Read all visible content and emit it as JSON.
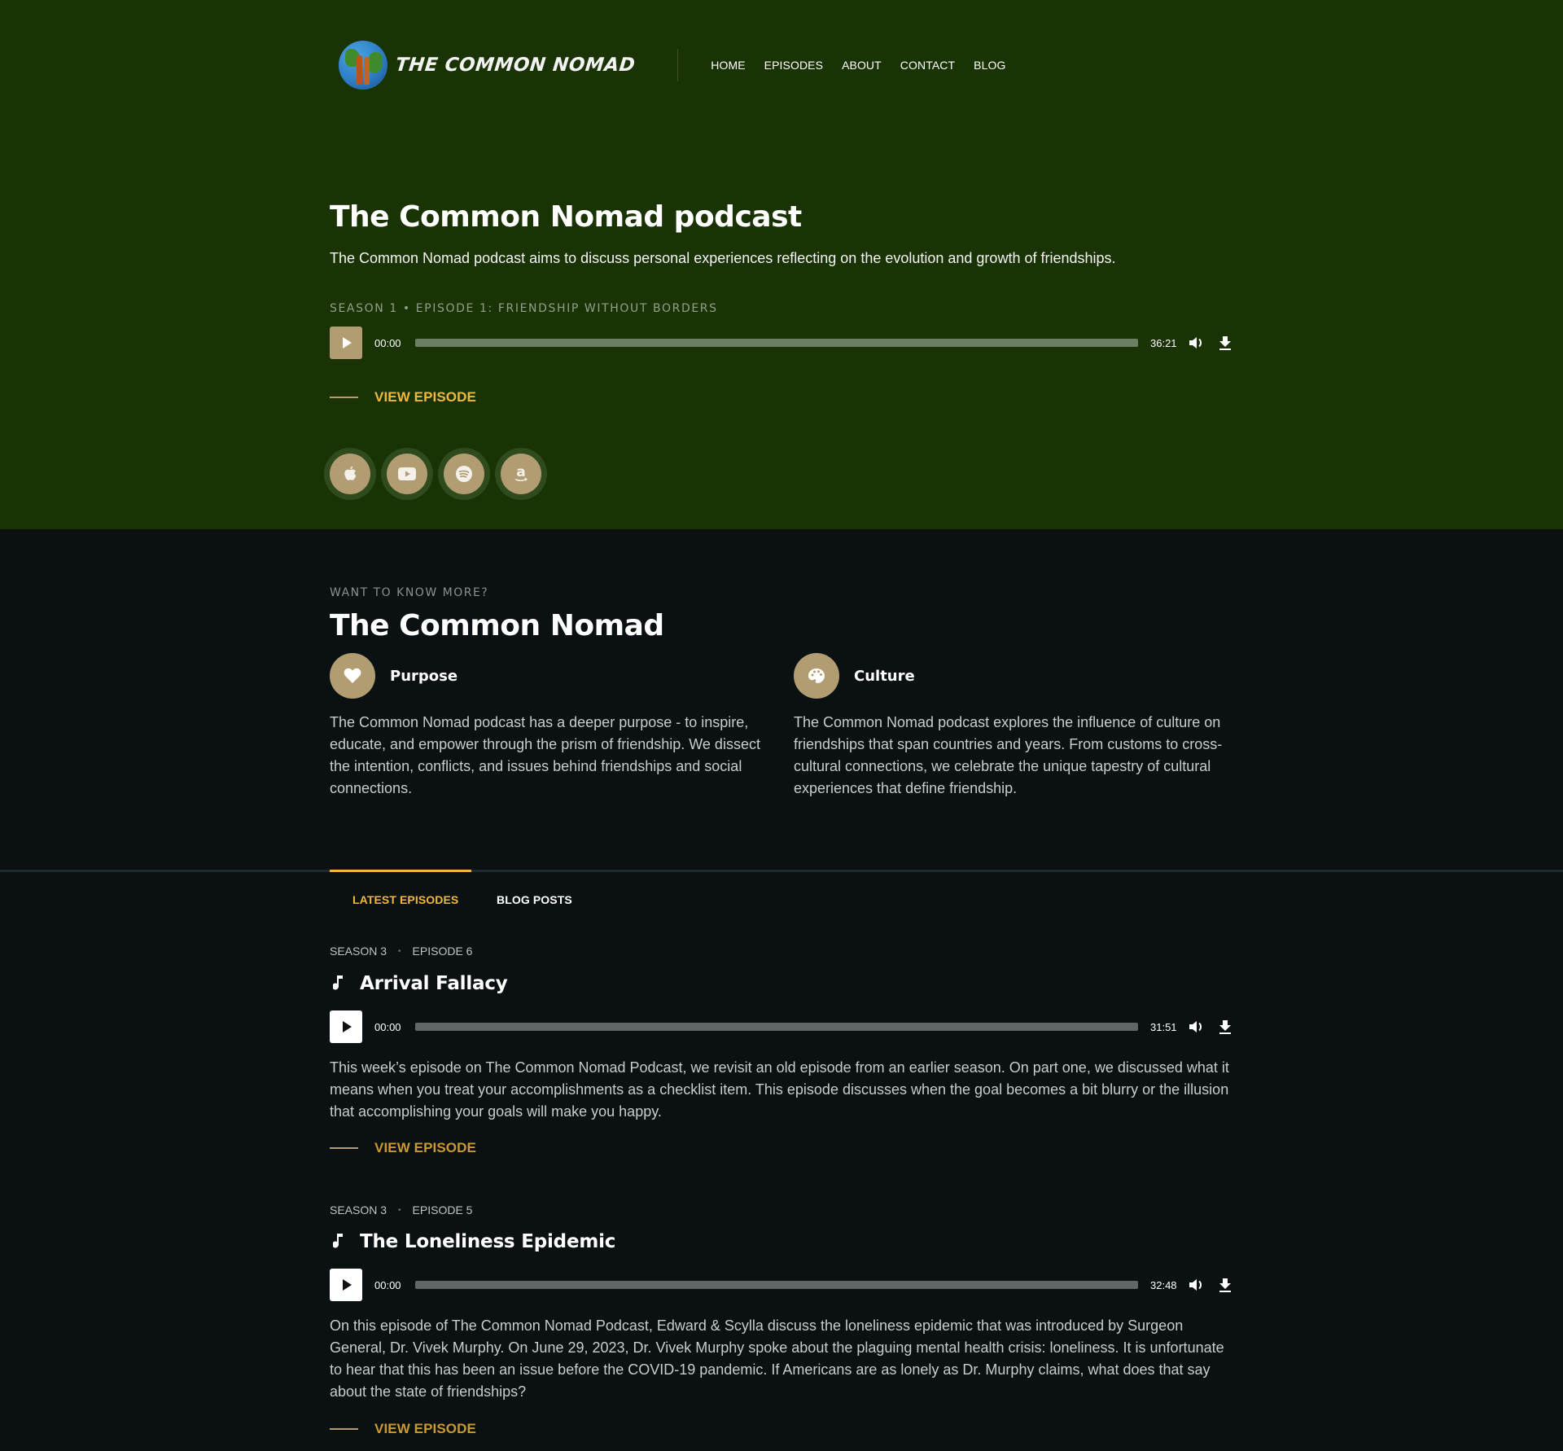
{
  "header": {
    "logo_text": "THE COMMON NOMAD",
    "nav": [
      "HOME",
      "EPISODES",
      "ABOUT",
      "CONTACT",
      "BLOG"
    ]
  },
  "hero": {
    "title": "The Common Nomad podcast",
    "description": "The Common Nomad podcast aims to discuss personal experiences reflecting on the evolution and growth of friendships.",
    "episode_label": "SEASON 1 • EPISODE 1: FRIENDSHIP WITHOUT BORDERS",
    "player": {
      "current_time": "00:00",
      "duration": "36:21",
      "progress": 0
    },
    "view_episode_label": "VIEW EPISODE",
    "platforms": [
      {
        "name": "Apple Podcasts",
        "icon": "apple-icon"
      },
      {
        "name": "YouTube",
        "icon": "youtube-icon"
      },
      {
        "name": "Spotify",
        "icon": "spotify-icon"
      },
      {
        "name": "Amazon Music",
        "icon": "amazon-icon"
      }
    ]
  },
  "about": {
    "kicker": "WANT TO KNOW MORE?",
    "title": "The Common Nomad",
    "features": [
      {
        "title": "Purpose",
        "icon": "heart-icon",
        "text": "The Common Nomad podcast has a deeper purpose - to inspire, educate, and empower through the prism of friendship. We dissect the intention, conflicts, and issues behind friendships and social connections."
      },
      {
        "title": "Culture",
        "icon": "palette-icon",
        "text": "The Common Nomad podcast explores the influence of culture on friendships that span countries and years. From customs to cross-cultural connections, we celebrate the unique tapestry of cultural experiences that define friendship."
      }
    ]
  },
  "tabs": [
    {
      "label": "LATEST EPISODES",
      "active": true
    },
    {
      "label": "BLOG POSTS",
      "active": false
    }
  ],
  "episodes": [
    {
      "season": "SEASON 3",
      "episode": "EPISODE 6",
      "title": "Arrival Fallacy",
      "player": {
        "current_time": "00:00",
        "duration": "31:51",
        "progress": 0
      },
      "description": "This week’s episode on The Common Nomad Podcast, we revisit an old episode from an earlier season. On part one, we discussed what it means when you treat your accomplishments as a checklist item. This episode discusses when the goal becomes a bit blurry or the illusion that accomplishing your goals will make you happy.",
      "view_label": "VIEW EPISODE"
    },
    {
      "season": "SEASON 3",
      "episode": "EPISODE 5",
      "title": "The Loneliness Epidemic",
      "player": {
        "current_time": "00:00",
        "duration": "32:48",
        "progress": 0
      },
      "description": "On this episode of The Common Nomad Podcast, Edward & Scylla discuss the loneliness epidemic that was introduced by Surgeon General, Dr. Vivek Murphy. On June 29, 2023, Dr. Vivek Murphy spoke about the plaguing mental health crisis: loneliness. It is unfortunate to hear that this has been an issue before the COVID-19 pandemic. If Americans are as lonely as Dr. Murphy claims, what does that say about the state of friendships?",
      "view_label": "VIEW EPISODE"
    }
  ],
  "colors": {
    "hero_bg": "#1a3305",
    "page_bg": "#0b1112",
    "accent_gold": "#f1b838",
    "tan": "#b29d73"
  }
}
